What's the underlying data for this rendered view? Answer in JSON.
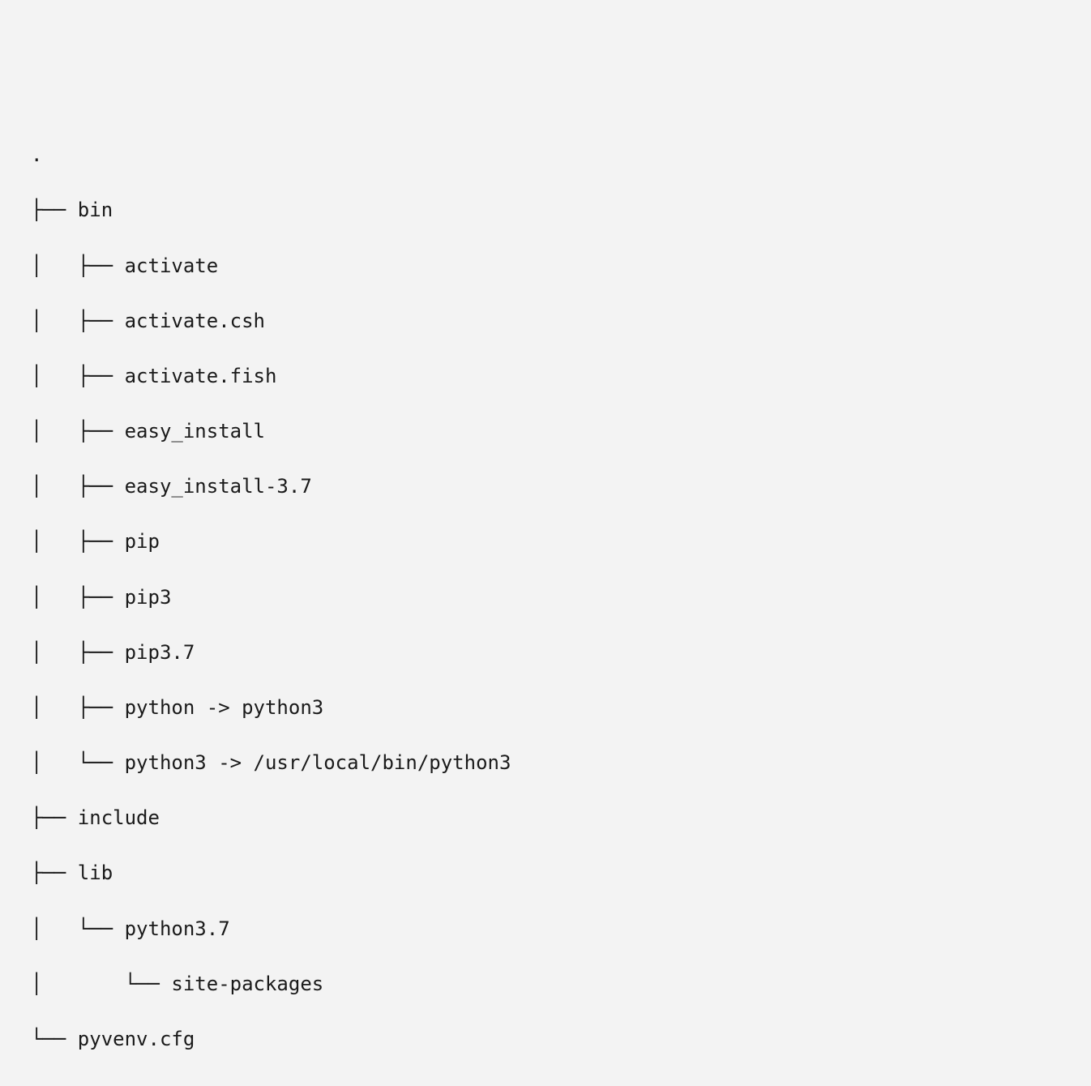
{
  "tree": {
    "lines": [
      ".",
      "├── bin",
      "│   ├── activate",
      "│   ├── activate.csh",
      "│   ├── activate.fish",
      "│   ├── easy_install",
      "│   ├── easy_install-3.7",
      "│   ├── pip",
      "│   ├── pip3",
      "│   ├── pip3.7",
      "│   ├── python -> python3",
      "│   └── python3 -> /usr/local/bin/python3",
      "├── include",
      "├── lib",
      "│   └── python3.7",
      "│       └── site-packages",
      "└── pyvenv.cfg"
    ]
  }
}
